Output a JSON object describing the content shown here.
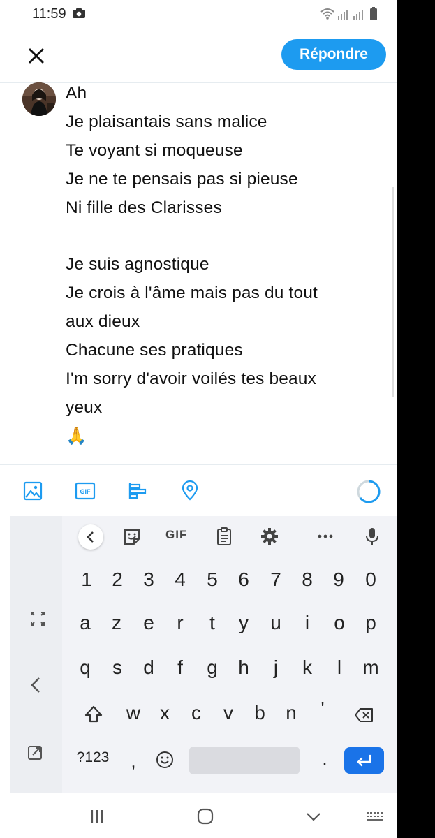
{
  "status_bar": {
    "time": "11:59"
  },
  "header": {
    "reply_label": "Répondre"
  },
  "compose": {
    "text": "Ah\nJe plaisantais sans malice\nTe voyant si moqueuse\nJe ne te pensais pas si pieuse\nNi fille des Clarisses\n\nJe suis agnostique\nJe crois à l'âme mais pas du tout\naux dieux\nChacune ses pratiques\nI'm sorry d'avoir voilés tes beaux\nyeux\n🙏"
  },
  "toolbar": {
    "gif_label": "GIF"
  },
  "keyboard": {
    "suggestion_gif_label": "GIF",
    "row_numbers": [
      "1",
      "2",
      "3",
      "4",
      "5",
      "6",
      "7",
      "8",
      "9",
      "0"
    ],
    "row_1": [
      "a",
      "z",
      "e",
      "r",
      "t",
      "y",
      "u",
      "i",
      "o",
      "p"
    ],
    "row_2": [
      "q",
      "s",
      "d",
      "f",
      "g",
      "h",
      "j",
      "k",
      "l",
      "m"
    ],
    "row_3": [
      "w",
      "x",
      "c",
      "v",
      "b",
      "n",
      "'"
    ],
    "symbols_label": "?123",
    "comma_label": ",",
    "period_label": "."
  },
  "colors": {
    "accent": "#1d9bf0",
    "enter_key": "#1a73e8"
  }
}
